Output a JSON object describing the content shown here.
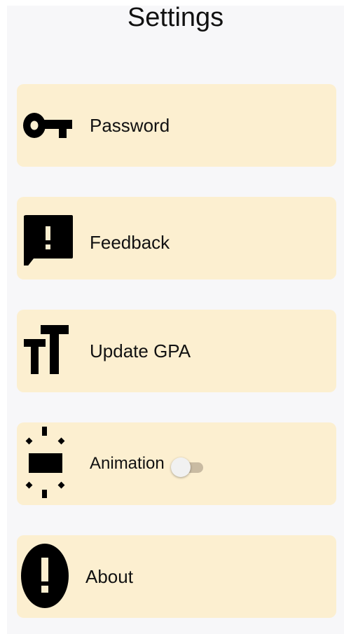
{
  "header": {
    "title": "Settings"
  },
  "colors": {
    "background": "#f7f7f9",
    "card": "#fcefd0",
    "text": "#111111",
    "toggle_track": "#c9bba2",
    "toggle_thumb": "#f1f1f1"
  },
  "settings": {
    "items": [
      {
        "label": "Password",
        "icon": "key-icon"
      },
      {
        "label": "Feedback",
        "icon": "feedback-icon"
      },
      {
        "label": "Update GPA",
        "icon": "text-size-icon"
      },
      {
        "label": "Animation",
        "icon": "animation-icon",
        "toggle": {
          "on": false
        }
      },
      {
        "label": "About",
        "icon": "info-icon"
      }
    ]
  }
}
